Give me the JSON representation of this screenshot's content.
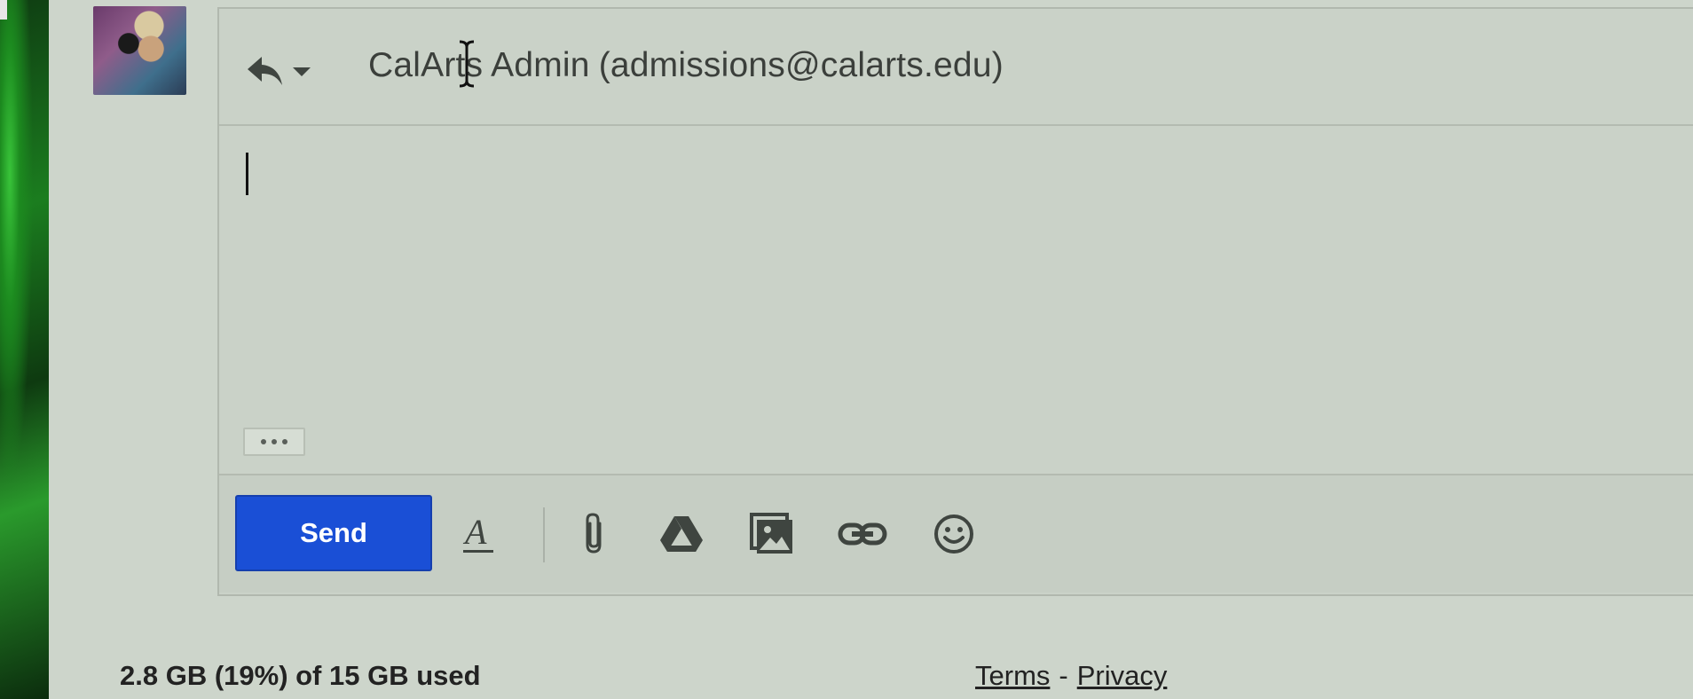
{
  "reply": {
    "recipient_name": "CalArts Admin",
    "recipient_email": "(admissions@calarts.edu)"
  },
  "compose": {
    "send_label": "Send"
  },
  "toolbar_icons": [
    "formatting-icon",
    "attach-icon",
    "drive-icon",
    "insert-photo-icon",
    "insert-link-icon",
    "emoji-icon"
  ],
  "footer": {
    "storage": "2.8 GB (19%) of 15 GB used",
    "terms": "Terms",
    "separator": "-",
    "privacy": "Privacy"
  },
  "colors": {
    "send_button": "#1a4fd6",
    "background": "#cdd5cb"
  }
}
